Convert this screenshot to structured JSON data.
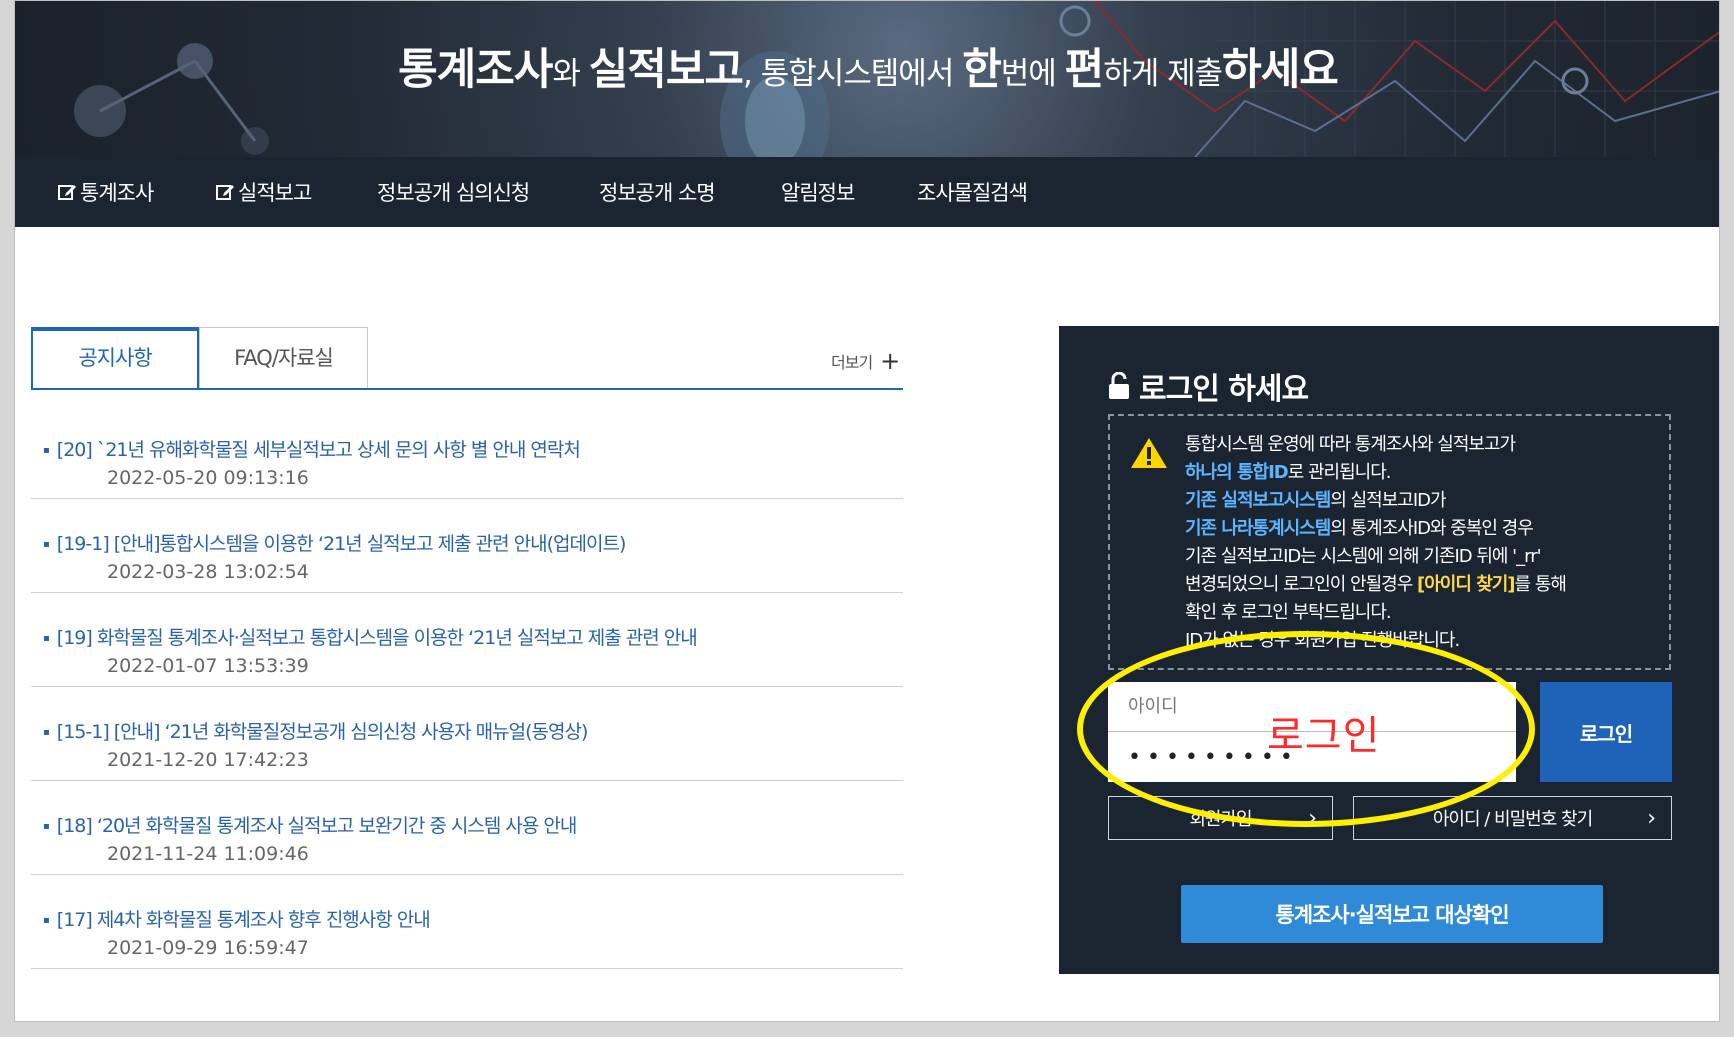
{
  "header": {
    "headline": [
      {
        "text": "통계조사",
        "style": "b"
      },
      {
        "text": "와 ",
        "style": "s"
      },
      {
        "text": "실적보고",
        "style": "b"
      },
      {
        "text": ", 통합시스템에서 ",
        "style": "s"
      },
      {
        "text": "한",
        "style": "b"
      },
      {
        "text": "번에 ",
        "style": "s"
      },
      {
        "text": "편",
        "style": "b"
      },
      {
        "text": "하게 제출",
        "style": "s"
      },
      {
        "text": "하세요",
        "style": "b"
      }
    ]
  },
  "nav": {
    "items": [
      "통계조사",
      "실적보고",
      "정보공개 심의신청",
      "정보공개 소명",
      "알림정보",
      "조사물질검색"
    ]
  },
  "tabs": {
    "notice": "공지사항",
    "faq": "FAQ/자료실",
    "more": "더보기"
  },
  "notices": [
    {
      "title": "[20] `21년 유해화학물질 세부실적보고 상세 문의 사항 별 안내 연락처",
      "date": "2022-05-20 09:13:16"
    },
    {
      "title": "[19-1] [안내]통합시스템을 이용한 ‘21년 실적보고 제출 관련 안내(업데이트)",
      "date": "2022-03-28 13:02:54"
    },
    {
      "title": "[19] 화학물질 통계조사·실적보고 통합시스템을 이용한 ‘21년 실적보고 제출 관련 안내",
      "date": "2022-01-07 13:53:39"
    },
    {
      "title": "[15-1] [안내] ‘21년 화학물질정보공개 심의신청 사용자 매뉴얼(동영상)",
      "date": "2021-12-20 17:42:23"
    },
    {
      "title": "[18] ‘20년 화학물질 통계조사 실적보고 보완기간 중 시스템 사용 안내",
      "date": "2021-11-24 11:09:46"
    },
    {
      "title": "[17] 제4차 화학물질 통계조사 향후 진행사항 안내",
      "date": "2021-09-29 16:59:47"
    }
  ],
  "login": {
    "title": "로그인 하세요",
    "info": {
      "l1": "통합시스템 운영에 따라 통계조사와 실적보고가",
      "l2a": "하나의 통합ID",
      "l2b": "로 관리됩니다.",
      "l3a": "기존 실적보고시스템",
      "l3b": "의 실적보고ID가",
      "l4a": "기존 나라통계시스템",
      "l4b": "의 통계조사ID와 중복인 경우",
      "l5": "기존 실적보고ID는 시스템에 의해 기존ID 뒤에 '_rr'",
      "l6a": "변경되었으니 로그인이 안될경우 ",
      "l6b": "[아이디 찾기]",
      "l6c": "를 통해",
      "l7": "확인 후 로그인 부탁드립니다.",
      "l8": "ID가 없는 경우 회원가입 진행바랍니다."
    },
    "id_placeholder": "아이디",
    "pw_value": "•••••••••",
    "login_button": "로그인",
    "join_button": "회원가입",
    "find_button": "아이디 / 비밀번호 찾기",
    "check_button": "통계조사·실적보고 대상확인"
  },
  "annotation": {
    "label": "로그인",
    "color": "#ff2a2a",
    "ellipse_color": "#ffef00"
  }
}
